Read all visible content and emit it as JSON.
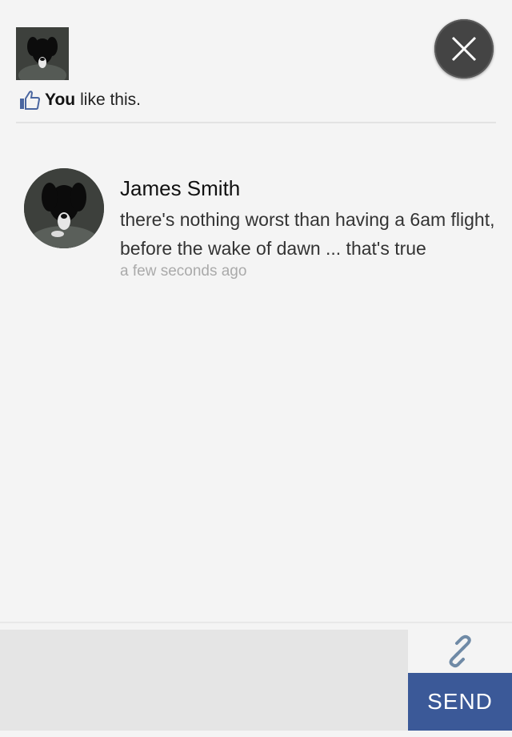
{
  "header": {
    "avatar_icon": "dog-photo-avatar",
    "close_icon": "close-icon"
  },
  "likes": {
    "icon": "thumbs-up-icon",
    "you_label": "You",
    "rest_label": "like this."
  },
  "comments": [
    {
      "author": "James Smith",
      "text": "there's nothing worst than having a 6am flight, before the wake of dawn ... that's true",
      "time": "a few seconds ago",
      "avatar_icon": "dog-photo-avatar"
    }
  ],
  "composer": {
    "input_value": "",
    "link_icon": "link-icon",
    "send_label": "SEND"
  },
  "colors": {
    "background": "#f4f4f4",
    "send_button": "#3b5998",
    "like_icon": "#4a66a0",
    "link_icon": "#6f8aa6",
    "close_button": "#444444"
  }
}
